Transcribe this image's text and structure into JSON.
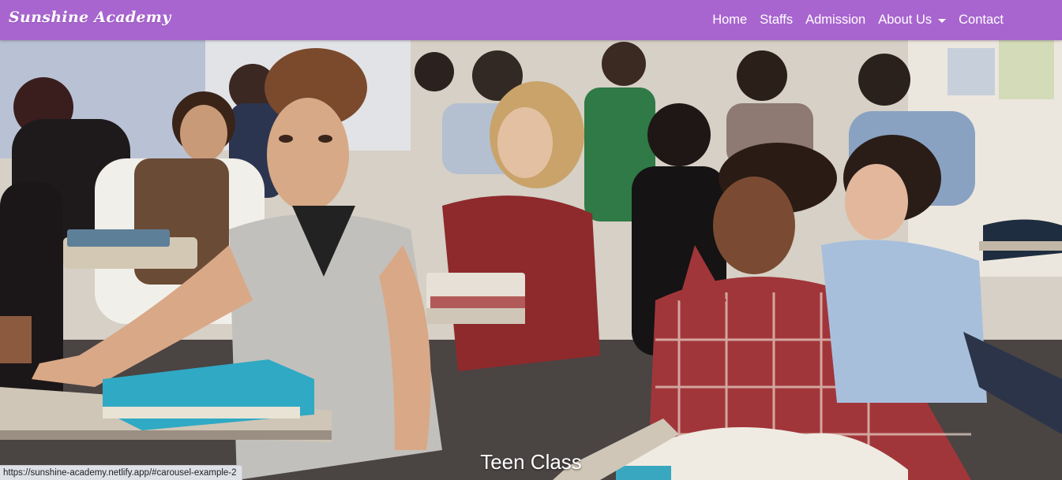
{
  "brand": {
    "name": "Sunshine Academy"
  },
  "nav": {
    "items": [
      {
        "label": "Home"
      },
      {
        "label": "Staffs"
      },
      {
        "label": "Admission"
      },
      {
        "label": "About Us",
        "dropdown": true
      },
      {
        "label": "Contact"
      }
    ]
  },
  "carousel": {
    "slide_caption": "Teen Class",
    "image_subject": "students-in-classroom"
  },
  "status_bar": {
    "url": "https://sunshine-academy.netlify.app/#carousel-example-2"
  },
  "colors": {
    "navbar_bg": "#a865cf",
    "nav_text": "#ffffff",
    "caption_text": "#ffffff"
  }
}
